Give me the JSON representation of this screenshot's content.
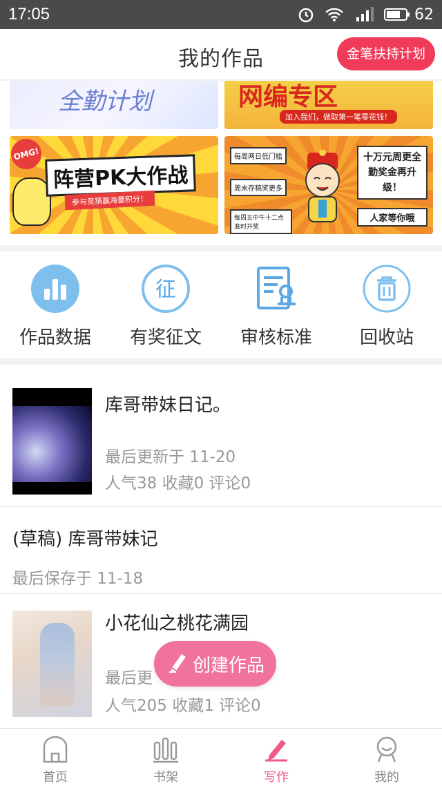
{
  "status_bar": {
    "time": "17:05",
    "network": "4G",
    "battery": "62"
  },
  "header": {
    "title": "我的作品",
    "action_button": "金笔扶持计划"
  },
  "banners": {
    "b1_text": "全勤计划",
    "b2_text": "网编专区",
    "b2_sub": "加入我们，做取第一笔零花钱！",
    "b3_badge": "OMG!",
    "b3_text": "阵营PK大作战",
    "b3_sub": "参与竞猜赢海量积分！",
    "b4_box1": "每周两日低门槛",
    "b4_box2": "周末存稿奖更多",
    "b4_box3": "每周五中午十二点准时开奖",
    "b4_big": "十万元周更全勤奖金再升级！",
    "b4_small": "人家等你哦"
  },
  "shortcuts": [
    {
      "label": "作品数据",
      "icon": "bar-chart-icon"
    },
    {
      "label": "有奖征文",
      "icon": "zheng-badge-icon"
    },
    {
      "label": "审核标准",
      "icon": "review-document-icon"
    },
    {
      "label": "回收站",
      "icon": "trash-icon"
    }
  ],
  "works": [
    {
      "title": "库哥带妹日记。",
      "updated": "最后更新于 11-20",
      "stats": "人气38 收藏0 评论0"
    },
    {
      "title": "(草稿) 库哥带妹记",
      "saved": "最后保存于 11-18"
    },
    {
      "title": "小花仙之桃花满园",
      "updated": "最后更",
      "stats": "人气205 收藏1 评论0"
    }
  ],
  "fab": {
    "label": "创建作品"
  },
  "bottom_nav": [
    {
      "label": "首页",
      "icon": "home-icon",
      "active": false
    },
    {
      "label": "书架",
      "icon": "bookshelf-icon",
      "active": false
    },
    {
      "label": "写作",
      "icon": "pencil-icon",
      "active": true
    },
    {
      "label": "我的",
      "icon": "profile-icon",
      "active": false
    }
  ],
  "colors": {
    "accent_pink": "#f05a87",
    "header_button": "#f03b5a",
    "icon_blue": "#5aa9e6",
    "fab": "#f1739b"
  }
}
